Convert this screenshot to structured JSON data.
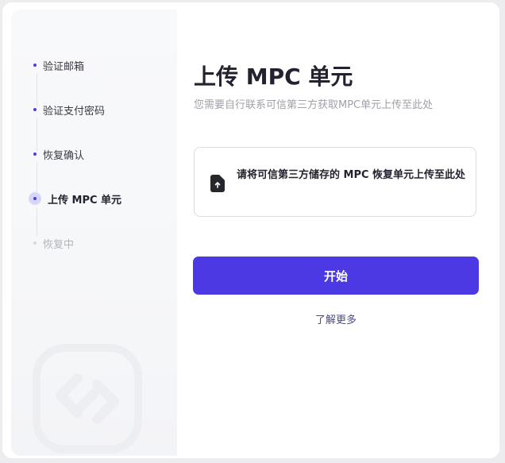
{
  "steps": [
    {
      "label": "验证邮箱",
      "state": "done"
    },
    {
      "label": "验证支付密码",
      "state": "done"
    },
    {
      "label": "恢复确认",
      "state": "done"
    },
    {
      "label": "上传 MPC 单元",
      "state": "active"
    },
    {
      "label": "恢复中",
      "state": "pending"
    }
  ],
  "main": {
    "title": "上传 MPC 单元",
    "subtitle": "您需要自行联系可信第三方获取MPC单元上传至此处",
    "upload_text": "请将可信第三方储存的 MPC 恢复单元上传至此处",
    "start_label": "开始",
    "learn_more_label": "了解更多"
  },
  "colors": {
    "accent": "#4b3ae3",
    "active_dot_bg": "#d8d5fa"
  }
}
